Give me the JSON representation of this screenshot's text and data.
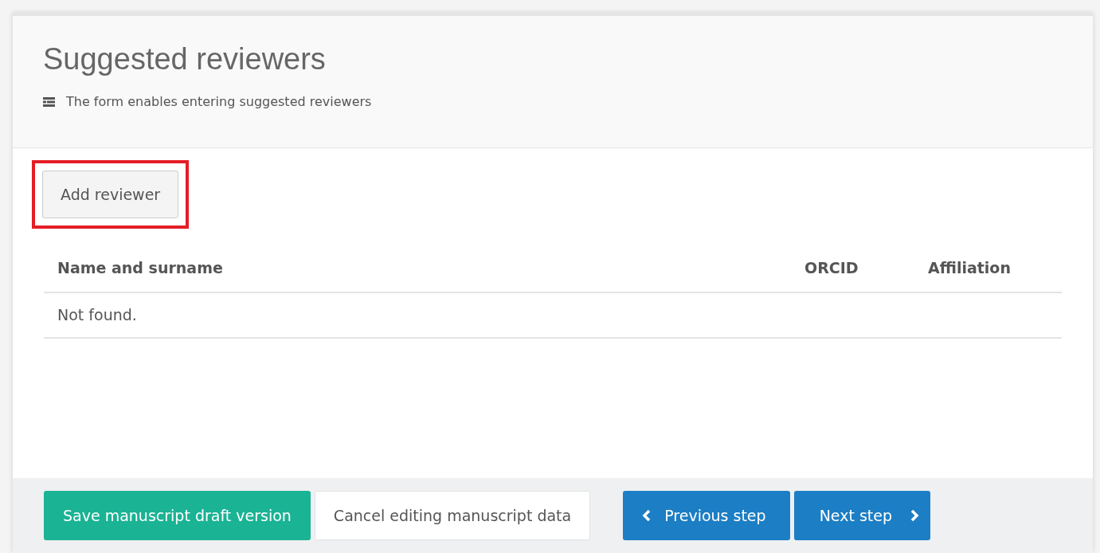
{
  "header": {
    "title": "Suggested reviewers",
    "description": "The form enables entering suggested reviewers"
  },
  "add_button": {
    "label": "Add reviewer",
    "highlighted": true
  },
  "table": {
    "columns": [
      "Name and surname",
      "ORCID",
      "Affiliation"
    ],
    "empty_message": "Not found."
  },
  "footer": {
    "buttons": [
      {
        "label": "Save manuscript draft version",
        "kind": "success"
      },
      {
        "label": "Cancel editing manuscript data",
        "kind": "plain"
      },
      {
        "label": "Previous step",
        "kind": "previous"
      },
      {
        "label": "Next step",
        "kind": "next"
      }
    ]
  }
}
